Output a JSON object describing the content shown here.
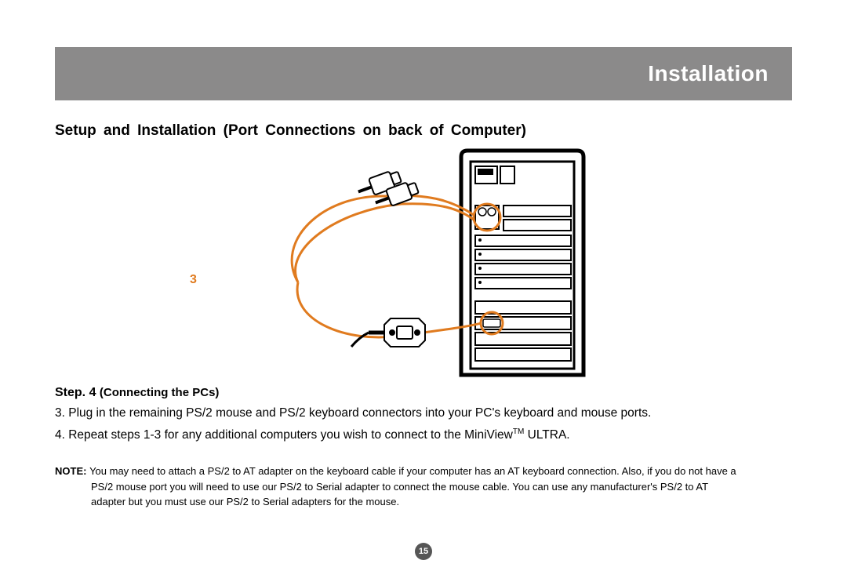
{
  "header": {
    "title": "Installation"
  },
  "section_title": "Setup and Installation (Port Connections on back of Computer)",
  "figure": {
    "callout_number": "3"
  },
  "step": {
    "prefix": "Step. 4 ",
    "title": "(Connecting the PCs)",
    "item3": "3. Plug in the remaining PS/2 mouse and PS/2 keyboard connectors into your PC's keyboard and mouse ports.",
    "item4_a": "4. Repeat steps 1-3 for any additional computers you wish to connect to the MiniView",
    "item4_tm": "TM",
    "item4_b": " ULTRA."
  },
  "note": {
    "label": "NOTE: ",
    "line1": "You may need to attach a PS/2 to AT adapter on the keyboard cable if your computer  has an AT keyboard connection.  Also, if you do not have a",
    "line2": "PS/2 mouse port you will need to use our PS/2 to Serial adapter to connect the mouse cable.  You can use any manufacturer's PS/2 to AT",
    "line3": "adapter but you must use our PS/2 to Serial adapters for the mouse."
  },
  "page_number": "15"
}
